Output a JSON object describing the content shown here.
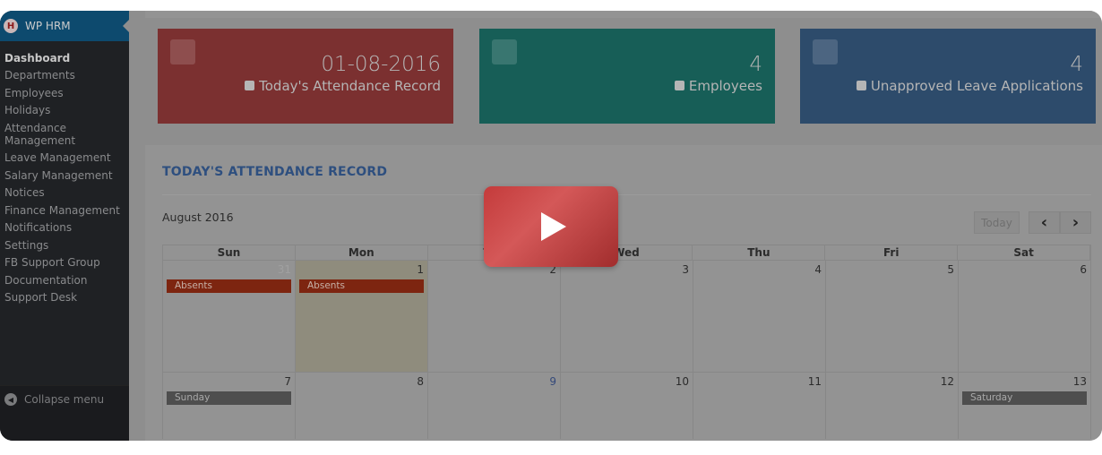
{
  "sidebar": {
    "brand": "WP HRM",
    "logo_letter": "H",
    "items": [
      {
        "label": "Dashboard",
        "active": true
      },
      {
        "label": "Departments"
      },
      {
        "label": "Employees"
      },
      {
        "label": "Holidays"
      },
      {
        "label": "Attendance Management"
      },
      {
        "label": "Leave Management"
      },
      {
        "label": "Salary Management"
      },
      {
        "label": "Notices"
      },
      {
        "label": "Finance Management"
      },
      {
        "label": "Notifications"
      },
      {
        "label": "Settings"
      },
      {
        "label": "FB Support Group"
      },
      {
        "label": "Documentation"
      },
      {
        "label": "Support Desk"
      }
    ],
    "collapse": "Collapse menu"
  },
  "cards": [
    {
      "value": "01-08-2016",
      "label": "Today's Attendance Record",
      "icon": "book-icon",
      "color": "#7b3030"
    },
    {
      "value": "4",
      "label": "Employees",
      "icon": "user-icon",
      "color": "#175e57"
    },
    {
      "value": "4",
      "label": "Unapproved Leave Applications",
      "icon": "envelope-icon",
      "color": "#2d4b6b"
    }
  ],
  "panel": {
    "title": "TODAY'S ATTENDANCE RECORD",
    "month": "August 2016",
    "today_button": "Today",
    "prev": "‹",
    "next": "›"
  },
  "calendar": {
    "days": [
      "Sun",
      "Mon",
      "Tue",
      "Wed",
      "Thu",
      "Fri",
      "Sat"
    ],
    "weeks": [
      [
        {
          "d": "31",
          "other": true,
          "event": "Absents",
          "type": "abs"
        },
        {
          "d": "1",
          "today": true,
          "event": "Absents",
          "type": "abs"
        },
        {
          "d": "2"
        },
        {
          "d": "3"
        },
        {
          "d": "4"
        },
        {
          "d": "5"
        },
        {
          "d": "6"
        }
      ],
      [
        {
          "d": "7",
          "event": "Sunday",
          "type": "hol"
        },
        {
          "d": "8"
        },
        {
          "d": "9",
          "blue": true
        },
        {
          "d": "10"
        },
        {
          "d": "11"
        },
        {
          "d": "12"
        },
        {
          "d": "13",
          "event": "Saturday",
          "type": "hol"
        }
      ]
    ]
  },
  "video": {
    "icon": "play-icon",
    "color": "#c94444"
  }
}
